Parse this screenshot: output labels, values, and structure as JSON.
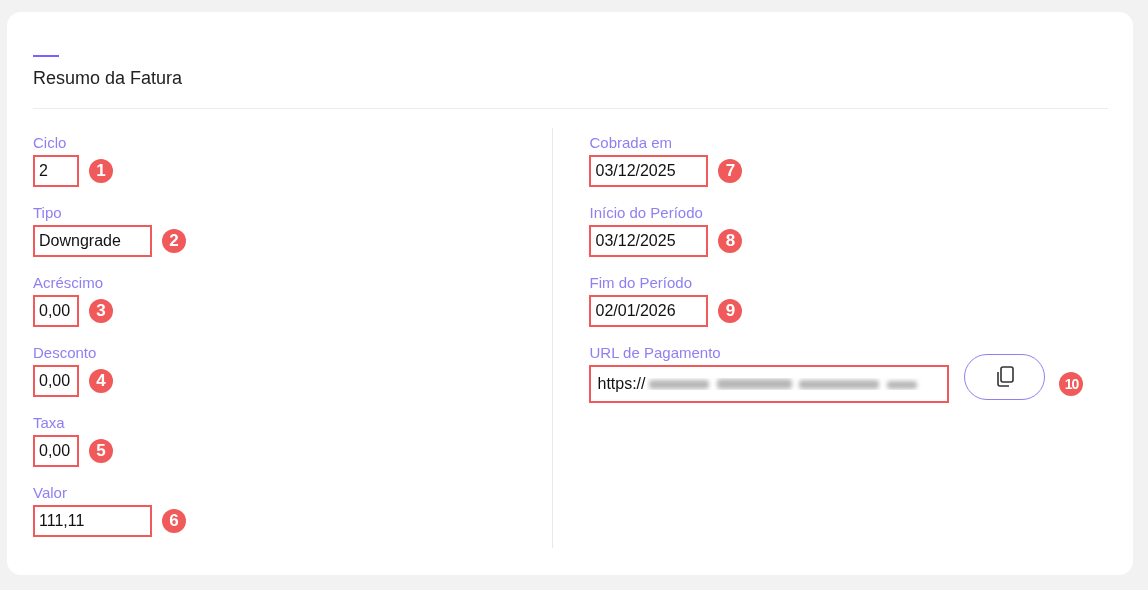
{
  "card": {
    "title": "Resumo da Fatura"
  },
  "left_fields": [
    {
      "label": "Ciclo",
      "value": "2",
      "kind": "narrow",
      "badge": "1"
    },
    {
      "label": "Tipo",
      "value": "Downgrade",
      "kind": "wide",
      "badge": "2"
    },
    {
      "label": "Acréscimo",
      "value": "0,00",
      "kind": "narrow",
      "badge": "3"
    },
    {
      "label": "Desconto",
      "value": "0,00",
      "kind": "narrow",
      "badge": "4"
    },
    {
      "label": "Taxa",
      "value": "0,00",
      "kind": "narrow",
      "badge": "5"
    },
    {
      "label": "Valor",
      "value": "111,11",
      "kind": "wide",
      "badge": "6"
    }
  ],
  "right_fields": [
    {
      "label": "Cobrada em",
      "value": "03/12/2025",
      "kind": "wide",
      "badge": "7"
    },
    {
      "label": "Início do Período",
      "value": "03/12/2025",
      "kind": "wide",
      "badge": "8"
    },
    {
      "label": "Fim do Período",
      "value": "02/01/2026",
      "kind": "wide",
      "badge": "9"
    }
  ],
  "url_field": {
    "label": "URL de Pagamento",
    "value": "https://",
    "redacted": true,
    "badge": "10"
  }
}
